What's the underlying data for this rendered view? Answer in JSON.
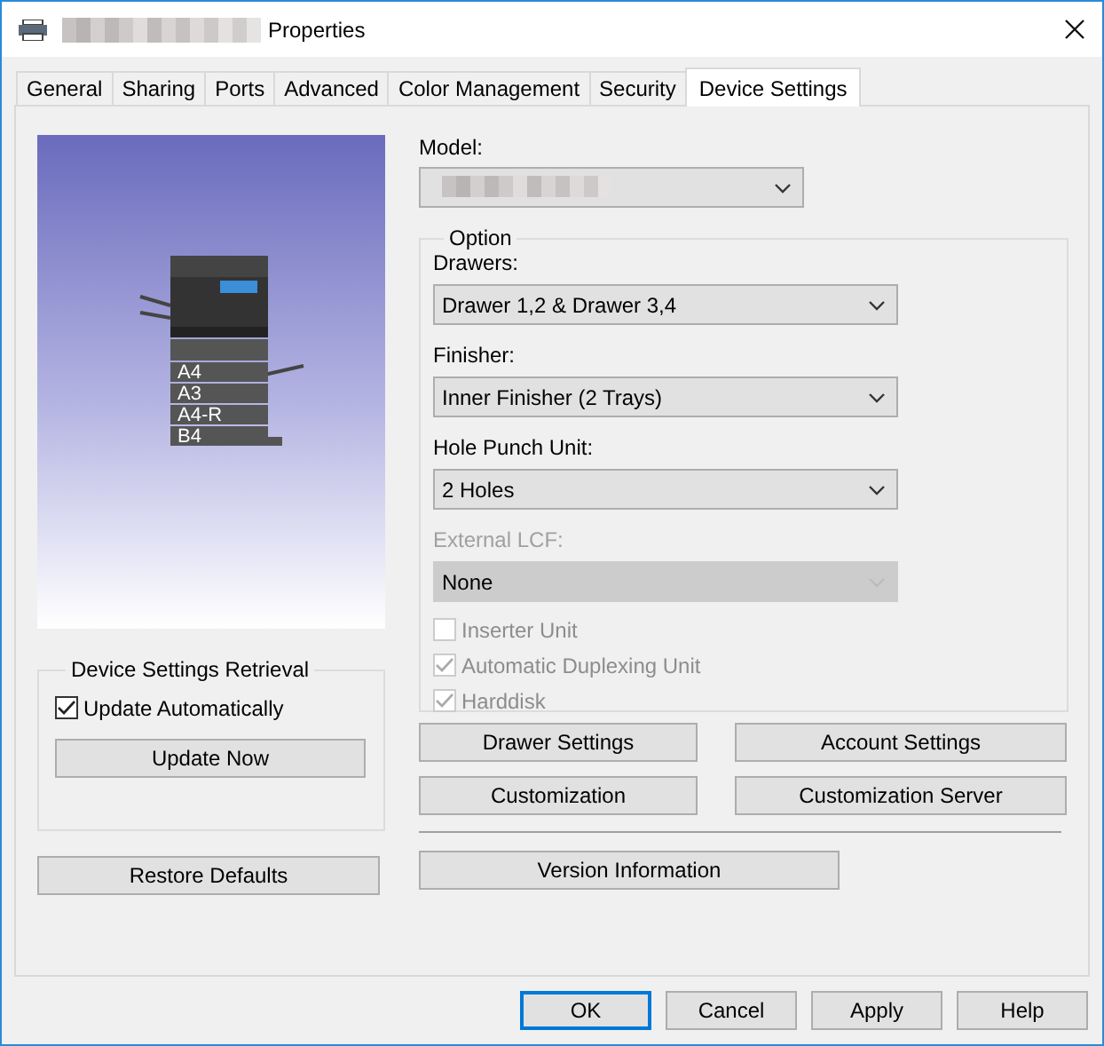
{
  "window": {
    "title": "Properties"
  },
  "tabs": [
    {
      "label": "General",
      "selected": false
    },
    {
      "label": "Sharing",
      "selected": false
    },
    {
      "label": "Ports",
      "selected": false
    },
    {
      "label": "Advanced",
      "selected": false
    },
    {
      "label": "Color Management",
      "selected": false
    },
    {
      "label": "Security",
      "selected": false
    },
    {
      "label": "Device Settings",
      "selected": true
    }
  ],
  "printer_image": {
    "tray_labels": [
      "A4",
      "A3",
      "A4-R",
      "B4"
    ]
  },
  "retrieval_group": {
    "title": "Device Settings Retrieval",
    "auto_update": {
      "label": "Update Automatically",
      "checked": true
    },
    "update_button": "Update Now"
  },
  "restore_button": "Restore Defaults",
  "model": {
    "label": "Model:"
  },
  "option_group": {
    "title": "Option",
    "dropdowns": [
      {
        "label": "Drawers:",
        "value": "Drawer 1,2 & Drawer 3,4",
        "disabled": false
      },
      {
        "label": "Finisher:",
        "value": "Inner Finisher (2 Trays)",
        "disabled": false
      },
      {
        "label": "Hole Punch Unit:",
        "value": "2 Holes",
        "disabled": false
      },
      {
        "label": "External LCF:",
        "value": "None",
        "disabled": true
      }
    ],
    "checkboxes": [
      {
        "label": "Inserter Unit",
        "checked": false,
        "disabled": true
      },
      {
        "label": "Automatic Duplexing Unit",
        "checked": true,
        "disabled": true
      },
      {
        "label": "Harddisk",
        "checked": true,
        "disabled": true
      }
    ]
  },
  "action_buttons": [
    "Drawer Settings",
    "Account Settings",
    "Customization",
    "Customization Server"
  ],
  "version_button": "Version Information",
  "dialog_buttons": [
    {
      "label": "OK",
      "default": true
    },
    {
      "label": "Cancel",
      "default": false
    },
    {
      "label": "Apply",
      "default": false
    },
    {
      "label": "Help",
      "default": false
    }
  ]
}
